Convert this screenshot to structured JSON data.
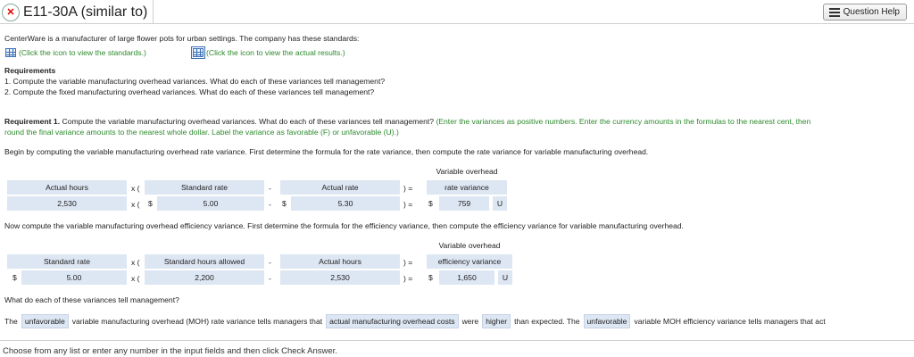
{
  "header": {
    "title": "E11-30A (similar to)",
    "help_label": "Question Help"
  },
  "intro": {
    "text": "CenterWare is a manufacturer of large flower pots for urban settings. The company has these standards:",
    "link_standards": "(Click the icon to view the standards.)",
    "link_actual": "(Click the icon to view the actual results.)"
  },
  "requirements": {
    "heading": "Requirements",
    "item1": "1. Compute the variable manufacturing overhead variances. What do each of these variances tell management?",
    "item2": "2. Compute the fixed manufacturing overhead variances. What do each of these variances tell management?"
  },
  "req1": {
    "label": "Requirement 1.",
    "text": "Compute the variable manufacturing overhead variances. What do each of these variances tell management?",
    "hint_line1": "(Enter the variances as positive numbers. Enter the currency amounts in the formulas to the nearest cent, then",
    "hint_line2": "round the final variance amounts to the nearest whole dollar. Label the variance as favorable (F) or unfavorable (U).)"
  },
  "rate_section": {
    "instruction": "Begin by computing the variable manufacturing overhead rate variance. First determine the formula for the rate variance, then compute the rate variance for variable manufacturing overhead.",
    "result_header_line1": "Variable overhead",
    "result_header_line2": "rate variance",
    "col1_header": "Actual hours",
    "col2_header": "Standard rate",
    "col3_header": "Actual rate",
    "col1_value": "2,530",
    "col2_value": "5.00",
    "col3_value": "5.30",
    "result_value": "759",
    "result_label": "U",
    "symbols": {
      "times_open": "x (",
      "minus": "-",
      "close_equals": ") =",
      "dollar": "$"
    }
  },
  "efficiency_section": {
    "instruction": "Now compute the variable manufacturing overhead efficiency variance. First determine the formula for the efficiency variance, then compute the efficiency variance for variable manufacturing overhead.",
    "result_header_line1": "Variable overhead",
    "result_header_line2": "efficiency variance",
    "col1_header": "Standard rate",
    "col2_header": "Standard hours allowed",
    "col3_header": "Actual hours",
    "col1_value": "5.00",
    "col2_value": "2,200",
    "col3_value": "2,530",
    "result_value": "1,650",
    "result_label": "U"
  },
  "question": {
    "text": "What do each of these variances tell management?"
  },
  "answer_sentence": {
    "part1": "The",
    "sel1": "unfavorable",
    "part2": "variable manufacturing overhead (MOH) rate variance tells managers that",
    "sel2": "actual manufacturing overhead costs",
    "part3": "were",
    "sel3": "higher",
    "part4": "than expected. The",
    "sel4": "unfavorable",
    "part5": "variable MOH efficiency variance tells managers that act"
  },
  "footer": {
    "text": "Choose from any list or enter any number in the input fields and then click Check Answer."
  },
  "colors": {
    "input_bg": "#dde6f3",
    "hint_green": "#2c8a2c"
  }
}
